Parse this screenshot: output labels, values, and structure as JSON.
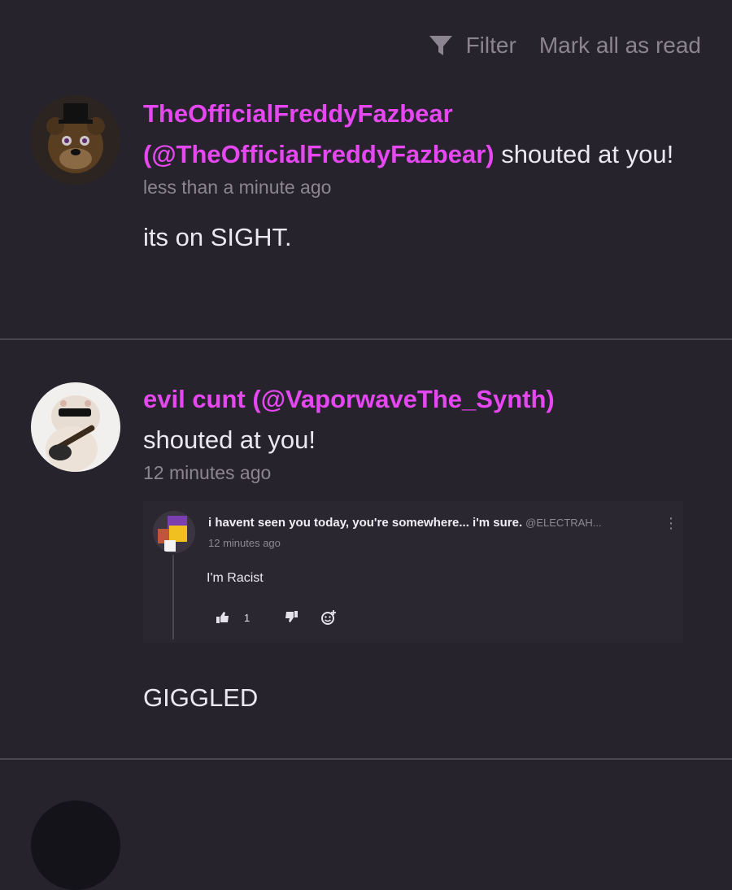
{
  "toolbar": {
    "filter_label": "Filter",
    "mark_all_label": "Mark all as read",
    "filter_icon": "filter-funnel-icon"
  },
  "notifications": [
    {
      "user_display": "TheOfficialFreddyFazbear",
      "user_handle": "(@TheOfficialFreddyFazbear)",
      "action": " shouted at you!",
      "time": "less than a minute ago",
      "message": "its on SIGHT.",
      "avatar_icon": "freddy-fazbear-avatar"
    },
    {
      "user_display": "evil cunt",
      "user_handle": "(@VaporwaveThe_Synth)",
      "action": "shouted at you!",
      "time": "12 minutes ago",
      "message": "GIGGLED",
      "avatar_icon": "hamster-guitar-avatar",
      "embed": {
        "title": "i havent seen you today, you're somewhere... i'm sure.",
        "handle": "@ELECTRAH...",
        "time": "12 minutes ago",
        "text": "I'm Racist",
        "like_count": "1"
      }
    }
  ],
  "colors": {
    "background": "#27232c",
    "username": "#e548f0",
    "muted": "#8b8690",
    "divider": "#4a4650"
  }
}
